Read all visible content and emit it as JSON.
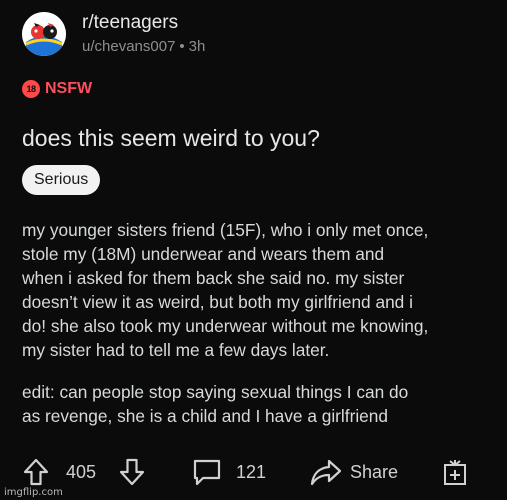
{
  "post": {
    "subreddit": "r/teenagers",
    "author": "u/chevans007",
    "separator": "•",
    "age": "3h",
    "nsfw_badge": "18",
    "nsfw_label": "NSFW",
    "title": "does this seem weird to you?",
    "flair": "Serious",
    "body_lines": [
      "my younger sisters friend (15F), who i only met once,",
      "stole my (18M) underwear and wears them and",
      "when i asked for them back she said no. my sister",
      "doesn’t view it as weird, but both my girlfriend and i",
      "do! she also took my underwear without me knowing,",
      "my sister had to tell me a few days later."
    ],
    "edit_lines": [
      "edit: can people stop saying sexual things I can do",
      "as revenge, she is a child and I have a girlfriend"
    ]
  },
  "actions": {
    "upvote_icon": "arrow-up-icon",
    "score": "405",
    "downvote_icon": "arrow-down-icon",
    "comment_icon": "comment-icon",
    "comments": "121",
    "share_icon": "share-arrow-icon",
    "share_label": "Share",
    "award_icon": "gift-add-icon"
  },
  "watermark": "imgflip.com",
  "colors": {
    "background": "#0b0b0b",
    "nsfw": "#ff4f5e",
    "text": "#d7dadc",
    "muted": "#8b8f93",
    "flair_bg": "#f2f2f2"
  }
}
